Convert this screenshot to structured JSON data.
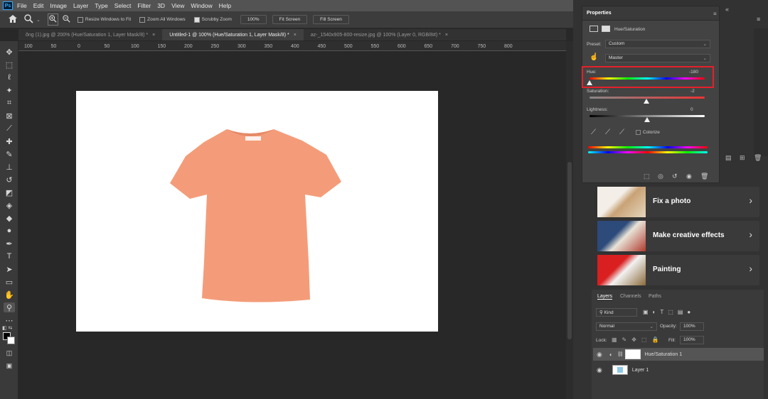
{
  "app": {
    "logo": "Ps"
  },
  "menu": [
    "File",
    "Edit",
    "Image",
    "Layer",
    "Type",
    "Select",
    "Filter",
    "3D",
    "View",
    "Window",
    "Help"
  ],
  "window_controls": [
    "–",
    "☐",
    "✕"
  ],
  "options": {
    "resize_windows": "Resize Windows to Fit",
    "zoom_all": "Zoom All Windows",
    "scrubby_zoom": "Scrubby Zoom",
    "zoom_value": "100%",
    "fit_screen": "Fit Screen",
    "fill_screen": "Fill Screen"
  },
  "tabs": [
    {
      "label": "ông (1).jpg @ 200% (Hue/Saturation 1, Layer Mask/8) *",
      "close": "×"
    },
    {
      "label": "Untitled-1 @ 100% (Hue/Saturation 1, Layer Mask/8) *",
      "close": "×"
    },
    {
      "label": "az-_1540x905-800-resize.jpg @ 100% (Layer 0, RGB/8#) *",
      "close": "×"
    }
  ],
  "ruler": [
    "100",
    "50",
    "0",
    "50",
    "100",
    "150",
    "200",
    "250",
    "300",
    "350",
    "400",
    "450",
    "500",
    "550",
    "600",
    "650",
    "700",
    "750",
    "800"
  ],
  "properties": {
    "title": "Properties",
    "adjustment": "Hue/Saturation",
    "preset_label": "Preset:",
    "preset_value": "Custom",
    "channel": "Master",
    "hue_label": "Hue:",
    "hue_value": "-180",
    "sat_label": "Saturation:",
    "sat_value": "-2",
    "light_label": "Lightness:",
    "light_value": "0",
    "colorize": "Colorize"
  },
  "learn": [
    {
      "title": "Fix a photo",
      "colors": [
        "#f3efe8",
        "#c9a276",
        "#e4d6bd"
      ]
    },
    {
      "title": "Make creative effects",
      "colors": [
        "#2c4a7a",
        "#e9e3d7",
        "#b03a2e"
      ]
    },
    {
      "title": "Painting",
      "colors": [
        "#d91f1f",
        "#f2f2f2",
        "#8a6a3a"
      ]
    }
  ],
  "layers": {
    "tabs": [
      "Layers",
      "Channels",
      "Paths"
    ],
    "kind": "Kind",
    "blend": "Normal",
    "opacity_label": "Opacity:",
    "opacity_value": "100%",
    "lock_label": "Lock:",
    "fill_label": "Fill:",
    "fill_value": "100%",
    "rows": [
      {
        "name": "Hue/Saturation 1"
      },
      {
        "name": "Layer 1"
      }
    ]
  },
  "colors": {
    "shirt": "#f49c79",
    "highlight": "#e5202a"
  }
}
